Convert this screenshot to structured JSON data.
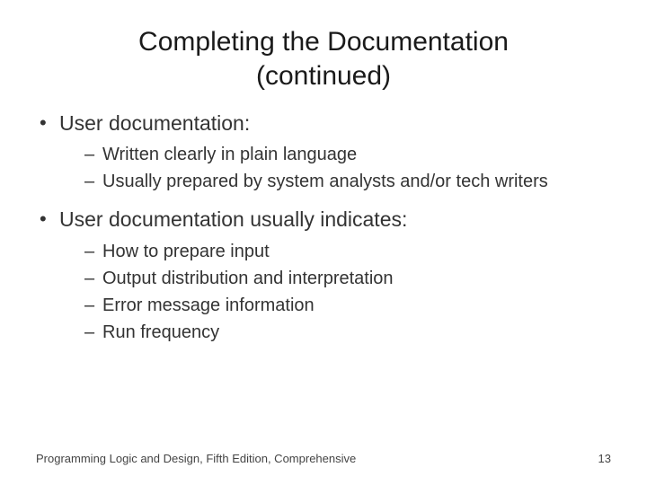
{
  "title_line1": "Completing the Documentation",
  "title_line2": "(continued)",
  "bullets": [
    {
      "text": "User documentation:",
      "sub": [
        "Written clearly in plain language",
        "Usually prepared by system analysts and/or tech writers"
      ]
    },
    {
      "text": "User documentation usually indicates:",
      "sub": [
        "How to prepare input",
        "Output distribution and interpretation",
        "Error message information",
        "Run frequency"
      ]
    }
  ],
  "footer_left": "Programming Logic and Design, Fifth Edition, Comprehensive",
  "footer_right": "13"
}
